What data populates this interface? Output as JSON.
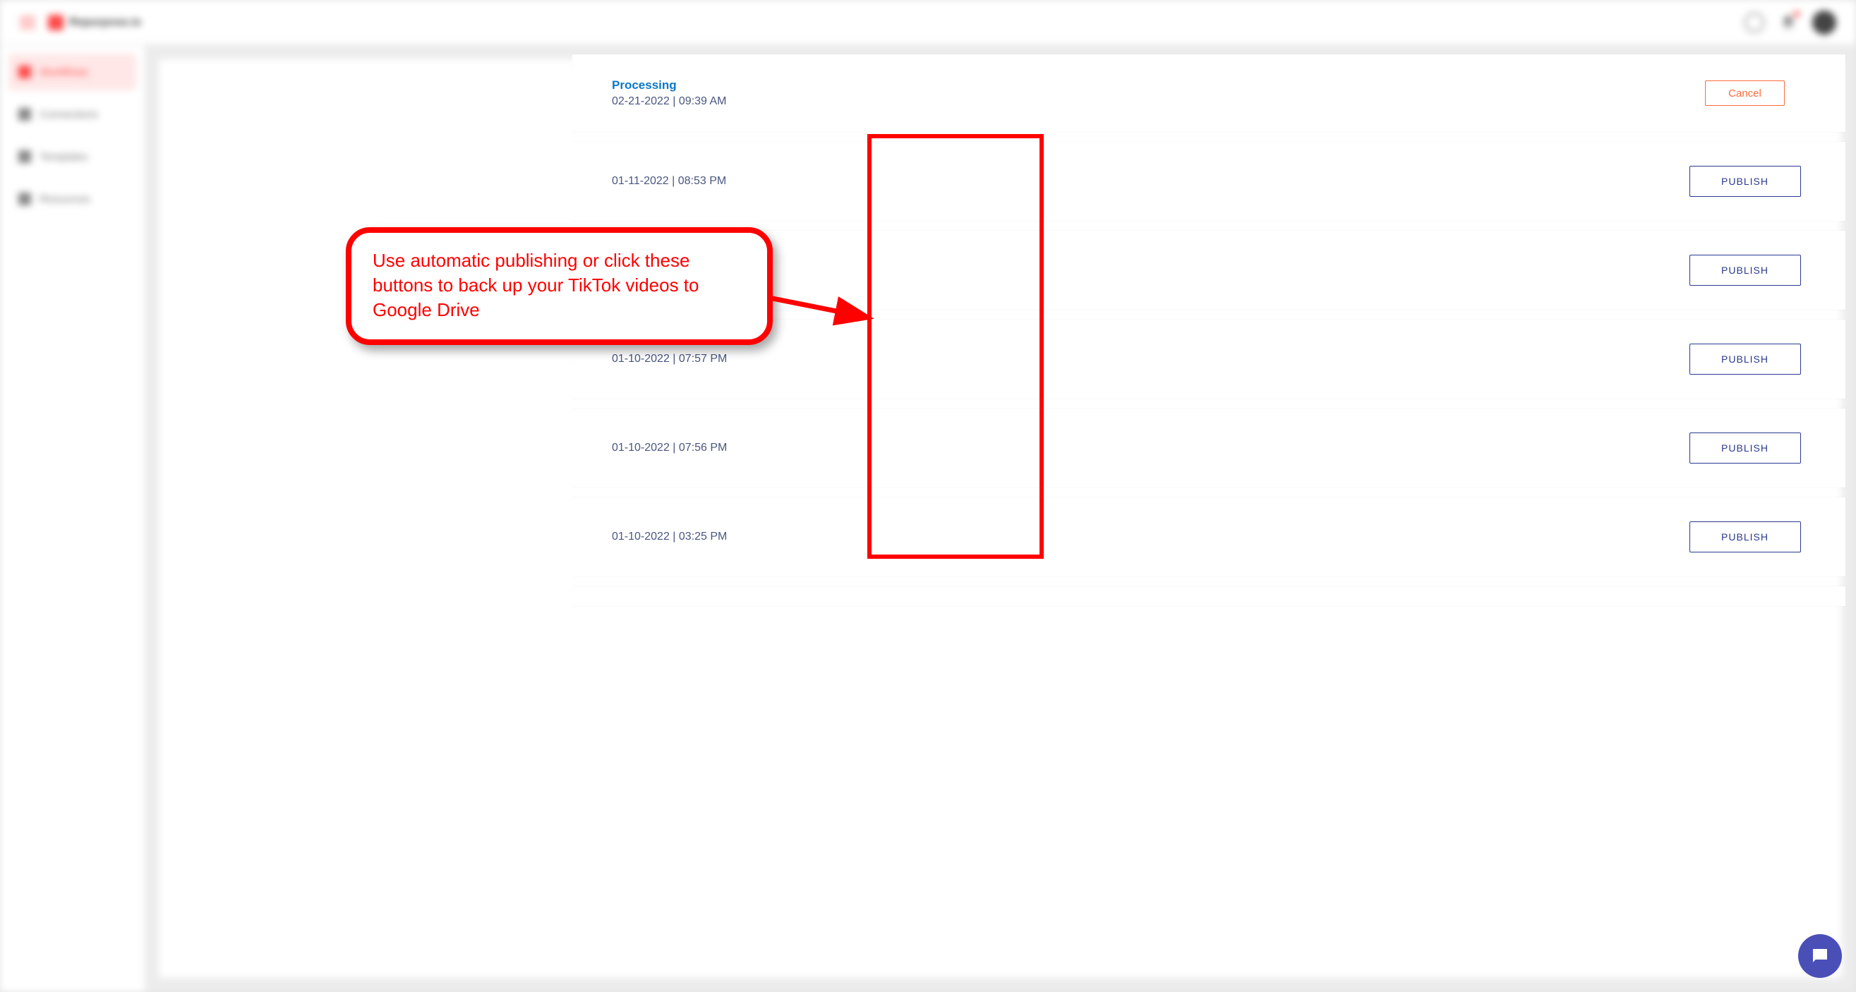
{
  "app": {
    "brand_name": "Repurpose.io"
  },
  "sidebar": {
    "items": [
      {
        "label": "Workflows"
      },
      {
        "label": "Connections"
      },
      {
        "label": "Templates"
      },
      {
        "label": "Resources"
      }
    ]
  },
  "rows": [
    {
      "status": "Processing",
      "datetime": "02-21-2022 | 09:39 AM",
      "action_label": "Cancel",
      "action_kind": "cancel"
    },
    {
      "status": "",
      "datetime": "01-11-2022 | 08:53 PM",
      "action_label": "PUBLISH",
      "action_kind": "publish"
    },
    {
      "status": "",
      "datetime": "",
      "action_label": "PUBLISH",
      "action_kind": "publish"
    },
    {
      "status": "",
      "datetime": "01-10-2022 | 07:57 PM",
      "action_label": "PUBLISH",
      "action_kind": "publish"
    },
    {
      "status": "",
      "datetime": "01-10-2022 | 07:56 PM",
      "action_label": "PUBLISH",
      "action_kind": "publish"
    },
    {
      "status": "",
      "datetime": "01-10-2022 | 03:25 PM",
      "action_label": "PUBLISH",
      "action_kind": "publish"
    }
  ],
  "callout": {
    "text": "Use automatic publishing or click these buttons to back up your TikTok videos to Google Drive"
  },
  "colors": {
    "accent_red": "#ff0000",
    "publish_blue": "#2b3a8f",
    "cancel_orange": "#ff6b3d",
    "status_blue": "#0a78c8"
  }
}
